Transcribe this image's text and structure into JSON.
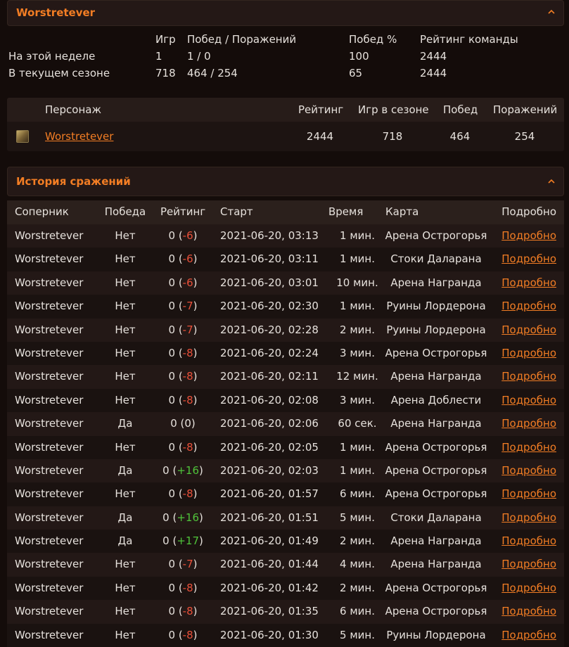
{
  "team_panel": {
    "title": "Worstretever"
  },
  "summary": {
    "headers": {
      "games": "Игр",
      "wl": "Побед / Поражений",
      "winpct": "Побед %",
      "rating": "Рейтинг команды"
    },
    "rows": [
      {
        "label": "На этой неделе",
        "games": "1",
        "wl": "1 / 0",
        "winpct": "100",
        "rating": "2444"
      },
      {
        "label": "В текущем сезоне",
        "games": "718",
        "wl": "464 / 254",
        "winpct": "65",
        "rating": "2444"
      }
    ]
  },
  "characters": {
    "headers": {
      "name": "Персонаж",
      "rating": "Рейтинг",
      "games": "Игр в сезоне",
      "wins": "Побед",
      "losses": "Поражений"
    },
    "rows": [
      {
        "icon": "character-portrait-icon",
        "name": "Worstretever",
        "rating": "2444",
        "games": "718",
        "wins": "464",
        "losses": "254"
      }
    ]
  },
  "history_panel": {
    "title": "История сражений"
  },
  "history": {
    "headers": {
      "opponent": "Соперник",
      "win": "Победа",
      "rating": "Рейтинг",
      "start": "Старт",
      "time": "Время",
      "map": "Карта",
      "details": "Подробно"
    },
    "rows": [
      {
        "opponent": "Worstretever",
        "win": "Нет",
        "rating": "0",
        "delta": "-6",
        "start": "2021-06-20, 03:13",
        "time": "1 мин.",
        "map": "Арена Острогорья",
        "details": "Подробно"
      },
      {
        "opponent": "Worstretever",
        "win": "Нет",
        "rating": "0",
        "delta": "-6",
        "start": "2021-06-20, 03:11",
        "time": "1 мин.",
        "map": "Стоки Даларана",
        "details": "Подробно"
      },
      {
        "opponent": "Worstretever",
        "win": "Нет",
        "rating": "0",
        "delta": "-6",
        "start": "2021-06-20, 03:01",
        "time": "10 мин.",
        "map": "Арена Награнда",
        "details": "Подробно"
      },
      {
        "opponent": "Worstretever",
        "win": "Нет",
        "rating": "0",
        "delta": "-7",
        "start": "2021-06-20, 02:30",
        "time": "1 мин.",
        "map": "Руины Лордерона",
        "details": "Подробно"
      },
      {
        "opponent": "Worstretever",
        "win": "Нет",
        "rating": "0",
        "delta": "-7",
        "start": "2021-06-20, 02:28",
        "time": "2 мин.",
        "map": "Руины Лордерона",
        "details": "Подробно"
      },
      {
        "opponent": "Worstretever",
        "win": "Нет",
        "rating": "0",
        "delta": "-8",
        "start": "2021-06-20, 02:24",
        "time": "3 мин.",
        "map": "Арена Острогорья",
        "details": "Подробно"
      },
      {
        "opponent": "Worstretever",
        "win": "Нет",
        "rating": "0",
        "delta": "-8",
        "start": "2021-06-20, 02:11",
        "time": "12 мин.",
        "map": "Арена Награнда",
        "details": "Подробно"
      },
      {
        "opponent": "Worstretever",
        "win": "Нет",
        "rating": "0",
        "delta": "-8",
        "start": "2021-06-20, 02:08",
        "time": "3 мин.",
        "map": "Арена Доблести",
        "details": "Подробно"
      },
      {
        "opponent": "Worstretever",
        "win": "Да",
        "rating": "0",
        "delta": "0",
        "start": "2021-06-20, 02:06",
        "time": "60 сек.",
        "map": "Арена Награнда",
        "details": "Подробно"
      },
      {
        "opponent": "Worstretever",
        "win": "Нет",
        "rating": "0",
        "delta": "-8",
        "start": "2021-06-20, 02:05",
        "time": "1 мин.",
        "map": "Арена Острогорья",
        "details": "Подробно"
      },
      {
        "opponent": "Worstretever",
        "win": "Да",
        "rating": "0",
        "delta": "+16",
        "start": "2021-06-20, 02:03",
        "time": "1 мин.",
        "map": "Арена Острогорья",
        "details": "Подробно"
      },
      {
        "opponent": "Worstretever",
        "win": "Нет",
        "rating": "0",
        "delta": "-8",
        "start": "2021-06-20, 01:57",
        "time": "6 мин.",
        "map": "Арена Острогорья",
        "details": "Подробно"
      },
      {
        "opponent": "Worstretever",
        "win": "Да",
        "rating": "0",
        "delta": "+16",
        "start": "2021-06-20, 01:51",
        "time": "5 мин.",
        "map": "Стоки Даларана",
        "details": "Подробно"
      },
      {
        "opponent": "Worstretever",
        "win": "Да",
        "rating": "0",
        "delta": "+17",
        "start": "2021-06-20, 01:49",
        "time": "2 мин.",
        "map": "Арена Награнда",
        "details": "Подробно"
      },
      {
        "opponent": "Worstretever",
        "win": "Нет",
        "rating": "0",
        "delta": "-7",
        "start": "2021-06-20, 01:44",
        "time": "4 мин.",
        "map": "Арена Награнда",
        "details": "Подробно"
      },
      {
        "opponent": "Worstretever",
        "win": "Нет",
        "rating": "0",
        "delta": "-8",
        "start": "2021-06-20, 01:42",
        "time": "2 мин.",
        "map": "Арена Острогорья",
        "details": "Подробно"
      },
      {
        "opponent": "Worstretever",
        "win": "Нет",
        "rating": "0",
        "delta": "-8",
        "start": "2021-06-20, 01:35",
        "time": "6 мин.",
        "map": "Арена Острогорья",
        "details": "Подробно"
      },
      {
        "opponent": "Worstretever",
        "win": "Нет",
        "rating": "0",
        "delta": "-8",
        "start": "2021-06-20, 01:30",
        "time": "5 мин.",
        "map": "Руины Лордерона",
        "details": "Подробно"
      }
    ]
  },
  "colors": {
    "accent": "#f27d24",
    "negative": "#e8503a",
    "positive": "#4fc23a",
    "background": "#140c0a"
  }
}
